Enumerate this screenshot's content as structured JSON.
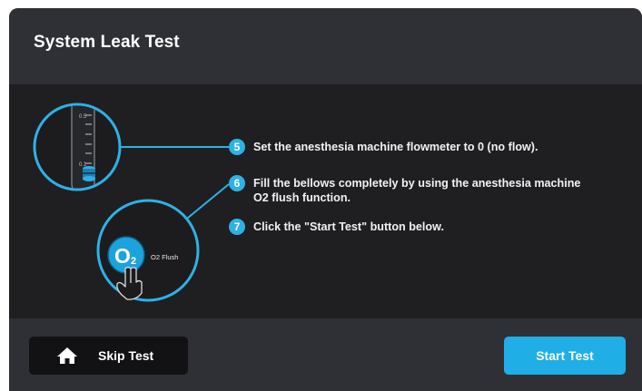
{
  "dialog": {
    "title": "System Leak Test"
  },
  "illustration": {
    "flowmeter_marks": [
      "0.5",
      "0.1"
    ],
    "o2_button_label": "O",
    "o2_button_subscript": "2",
    "o2_flush_label": "O2 Flush"
  },
  "steps": [
    {
      "number": "5",
      "text": "Set the anesthesia machine flowmeter to 0 (no flow)."
    },
    {
      "number": "6",
      "text": "Fill the bellows completely by using the anesthesia machine O2 flush function."
    },
    {
      "number": "7",
      "text": "Click the \"Start Test\" button below."
    }
  ],
  "footer": {
    "skip_label": "Skip Test",
    "start_label": "Start Test"
  },
  "colors": {
    "accent": "#20aee6",
    "header_bg": "#2f3035",
    "content_bg": "#1f1f21",
    "skip_bg": "#121214"
  }
}
